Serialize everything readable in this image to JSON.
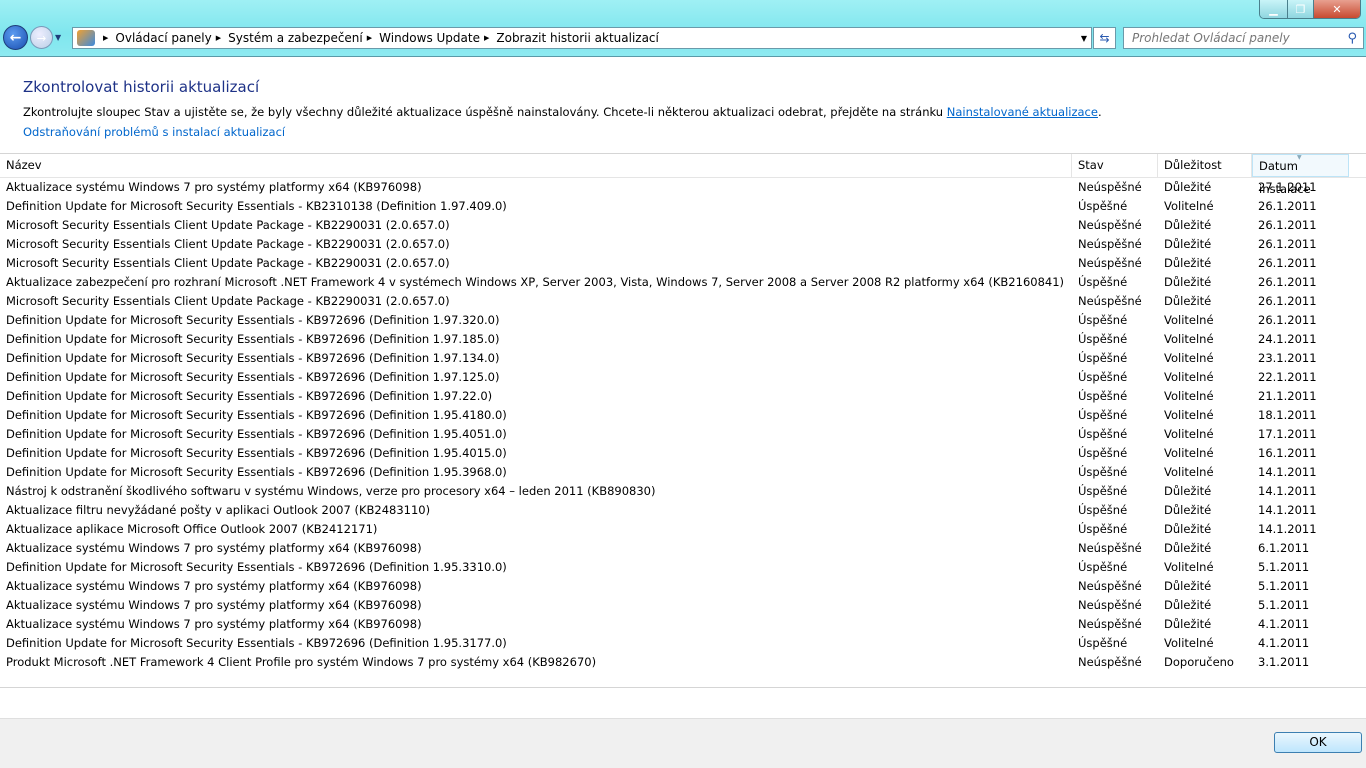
{
  "window": {
    "minimize_icon": "minimize-icon",
    "maximize_icon": "restore-icon",
    "close_icon": "close-icon"
  },
  "breadcrumb": [
    "Ovládací panely",
    "Systém a zabezpečení",
    "Windows Update",
    "Zobrazit historii aktualizací"
  ],
  "search": {
    "placeholder": "Prohledat Ovládací panely"
  },
  "page": {
    "title": "Zkontrolovat historii aktualizací",
    "desc_prefix": "Zkontrolujte sloupec Stav a ujistěte se, že byly všechny důležité aktualizace úspěšně nainstalovány. Chcete-li některou aktualizaci odebrat, přejděte na stránku ",
    "desc_link": "Nainstalované aktualizace",
    "desc_suffix": ".",
    "troubleshoot_link": "Odstraňování problémů s instalací aktualizací"
  },
  "columns": [
    "Název",
    "Stav",
    "Důležitost",
    "Datum instalace"
  ],
  "rows": [
    [
      "Aktualizace systému Windows 7 pro systémy platformy x64 (KB976098)",
      "Neúspěšné",
      "Důležité",
      "27.1.2011"
    ],
    [
      "Definition Update for Microsoft Security Essentials - KB2310138 (Definition 1.97.409.0)",
      "Úspěšné",
      "Volitelné",
      "26.1.2011"
    ],
    [
      "Microsoft Security Essentials Client Update Package - KB2290031 (2.0.657.0)",
      "Neúspěšné",
      "Důležité",
      "26.1.2011"
    ],
    [
      "Microsoft Security Essentials Client Update Package - KB2290031 (2.0.657.0)",
      "Neúspěšné",
      "Důležité",
      "26.1.2011"
    ],
    [
      "Microsoft Security Essentials Client Update Package - KB2290031 (2.0.657.0)",
      "Neúspěšné",
      "Důležité",
      "26.1.2011"
    ],
    [
      "Aktualizace zabezpečení pro rozhraní Microsoft .NET Framework 4 v systémech Windows XP, Server 2003, Vista, Windows 7, Server 2008 a Server 2008 R2 platformy x64 (KB2160841)",
      "Úspěšné",
      "Důležité",
      "26.1.2011"
    ],
    [
      "Microsoft Security Essentials Client Update Package - KB2290031 (2.0.657.0)",
      "Neúspěšné",
      "Důležité",
      "26.1.2011"
    ],
    [
      "Definition Update for Microsoft Security Essentials - KB972696 (Definition 1.97.320.0)",
      "Úspěšné",
      "Volitelné",
      "26.1.2011"
    ],
    [
      "Definition Update for Microsoft Security Essentials - KB972696 (Definition 1.97.185.0)",
      "Úspěšné",
      "Volitelné",
      "24.1.2011"
    ],
    [
      "Definition Update for Microsoft Security Essentials - KB972696 (Definition 1.97.134.0)",
      "Úspěšné",
      "Volitelné",
      "23.1.2011"
    ],
    [
      "Definition Update for Microsoft Security Essentials - KB972696 (Definition 1.97.125.0)",
      "Úspěšné",
      "Volitelné",
      "22.1.2011"
    ],
    [
      "Definition Update for Microsoft Security Essentials - KB972696 (Definition 1.97.22.0)",
      "Úspěšné",
      "Volitelné",
      "21.1.2011"
    ],
    [
      "Definition Update for Microsoft Security Essentials - KB972696 (Definition 1.95.4180.0)",
      "Úspěšné",
      "Volitelné",
      "18.1.2011"
    ],
    [
      "Definition Update for Microsoft Security Essentials - KB972696 (Definition 1.95.4051.0)",
      "Úspěšné",
      "Volitelné",
      "17.1.2011"
    ],
    [
      "Definition Update for Microsoft Security Essentials - KB972696 (Definition 1.95.4015.0)",
      "Úspěšné",
      "Volitelné",
      "16.1.2011"
    ],
    [
      "Definition Update for Microsoft Security Essentials - KB972696 (Definition 1.95.3968.0)",
      "Úspěšné",
      "Volitelné",
      "14.1.2011"
    ],
    [
      "Nástroj k odstranění škodlivého softwaru v systému Windows, verze pro procesory x64 – leden 2011 (KB890830)",
      "Úspěšné",
      "Důležité",
      "14.1.2011"
    ],
    [
      "Aktualizace filtru nevyžádané pošty v aplikaci Outlook 2007 (KB2483110)",
      "Úspěšné",
      "Důležité",
      "14.1.2011"
    ],
    [
      "Aktualizace aplikace Microsoft Office Outlook 2007 (KB2412171)",
      "Úspěšné",
      "Důležité",
      "14.1.2011"
    ],
    [
      "Aktualizace systému Windows 7 pro systémy platformy x64 (KB976098)",
      "Neúspěšné",
      "Důležité",
      "6.1.2011"
    ],
    [
      "Definition Update for Microsoft Security Essentials - KB972696 (Definition 1.95.3310.0)",
      "Úspěšné",
      "Volitelné",
      "5.1.2011"
    ],
    [
      "Aktualizace systému Windows 7 pro systémy platformy x64 (KB976098)",
      "Neúspěšné",
      "Důležité",
      "5.1.2011"
    ],
    [
      "Aktualizace systému Windows 7 pro systémy platformy x64 (KB976098)",
      "Neúspěšné",
      "Důležité",
      "5.1.2011"
    ],
    [
      "Aktualizace systému Windows 7 pro systémy platformy x64 (KB976098)",
      "Neúspěšné",
      "Důležité",
      "4.1.2011"
    ],
    [
      "Definition Update for Microsoft Security Essentials - KB972696 (Definition 1.95.3177.0)",
      "Úspěšné",
      "Volitelné",
      "4.1.2011"
    ],
    [
      "Produkt Microsoft .NET Framework 4 Client Profile pro systém Windows 7 pro systémy x64 (KB982670)",
      "Neúspěšné",
      "Doporučeno",
      "3.1.2011"
    ]
  ],
  "footer": {
    "ok_label": "OK"
  }
}
